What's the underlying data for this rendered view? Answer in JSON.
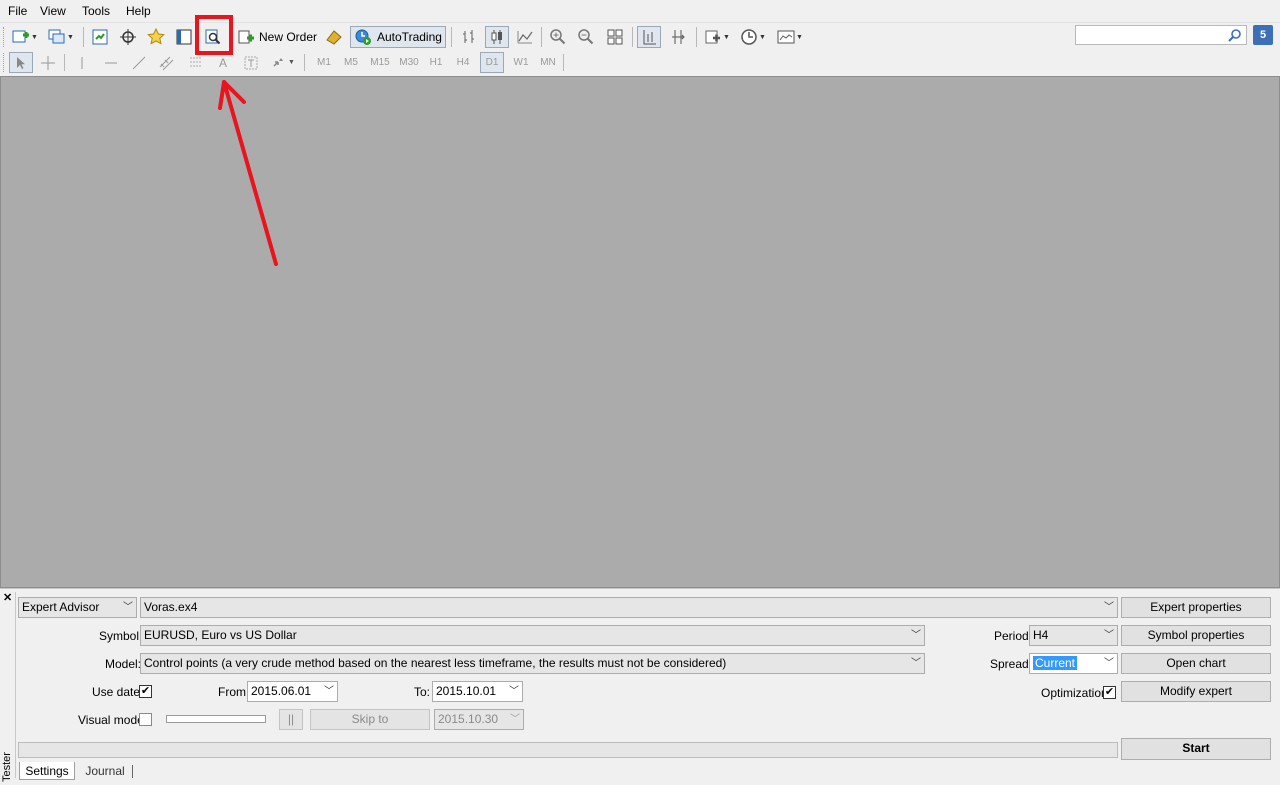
{
  "menu": {
    "items": [
      "File",
      "View",
      "Tools",
      "Help"
    ]
  },
  "toolbar": {
    "new_order_label": "New Order",
    "autotrading_label": "AutoTrading",
    "notification_count": "5",
    "search_placeholder": "",
    "icons": [
      "new-chart-icon",
      "profiles-icon",
      "market-watch-icon",
      "data-window-icon",
      "navigator-icon",
      "terminal-icon",
      "strategy-tester-icon",
      "new-order-icon",
      "metaeditor-icon",
      "autotrading-icon",
      "bar-chart-icon",
      "candlesticks-icon",
      "line-chart-icon",
      "zoom-in-icon",
      "zoom-out-icon",
      "tile-windows-icon",
      "chart-shift-icon",
      "autoscroll-icon",
      "indicators-icon",
      "periods-icon",
      "templates-icon",
      "search-icon"
    ]
  },
  "timeframes": [
    "M1",
    "M5",
    "M15",
    "M30",
    "H1",
    "H4",
    "D1",
    "W1",
    "MN"
  ],
  "tester": {
    "panel_title": "Tester",
    "mode_select": "Expert Advisor",
    "expert_file": "Voras.ex4",
    "symbol_label": "Symbol:",
    "symbol_value": "EURUSD, Euro vs US Dollar",
    "model_label": "Model:",
    "model_value": "Control points (a very crude method based on the nearest less timeframe, the results must not be considered)",
    "use_date_label": "Use date",
    "from_label": "From:",
    "from_value": "2015.06.01",
    "to_label": "To:",
    "to_value": "2015.10.01",
    "visual_mode_label": "Visual mode",
    "pause_label": "||",
    "skip_to_label": "Skip to",
    "skip_to_value": "2015.10.30",
    "period_label": "Period:",
    "period_value": "H4",
    "spread_label": "Spread:",
    "spread_value": "Current",
    "optimization_label": "Optimization",
    "buttons": {
      "expert_properties": "Expert properties",
      "symbol_properties": "Symbol properties",
      "open_chart": "Open chart",
      "modify_expert": "Modify expert",
      "start": "Start"
    },
    "tabs": [
      "Settings",
      "Journal"
    ],
    "use_date_checked": true,
    "visual_mode_checked": false,
    "optimization_checked": true
  },
  "annotation": {
    "color": "#e8141e"
  }
}
